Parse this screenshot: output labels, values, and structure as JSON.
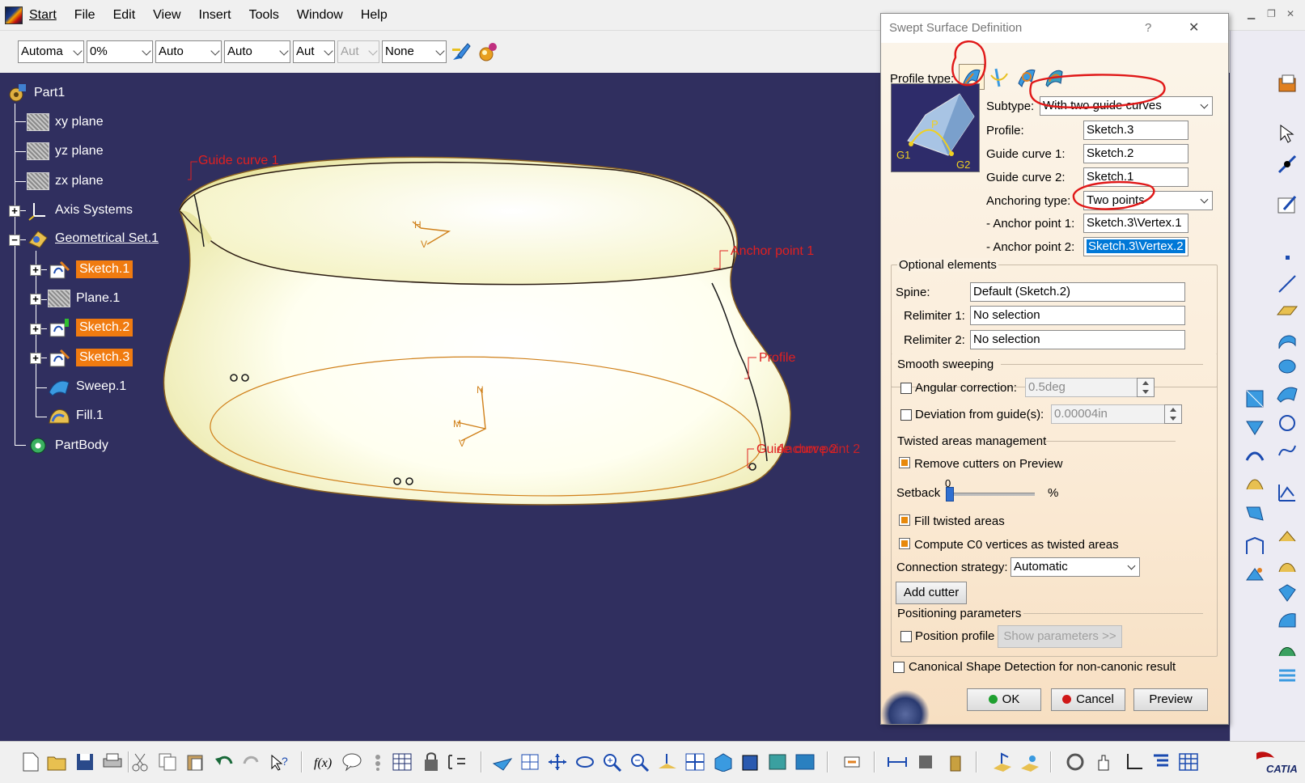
{
  "menu": {
    "items": [
      "Start",
      "File",
      "Edit",
      "View",
      "Insert",
      "Tools",
      "Window",
      "Help"
    ]
  },
  "toolbar": {
    "combos": [
      {
        "value": "Automa",
        "disabled": false
      },
      {
        "value": "0%",
        "disabled": false
      },
      {
        "value": "Auto",
        "disabled": false
      },
      {
        "value": "Auto",
        "disabled": false
      },
      {
        "value": "Aut",
        "disabled": false
      },
      {
        "value": "Aut",
        "disabled": true
      },
      {
        "value": "None",
        "disabled": false
      }
    ]
  },
  "tree": {
    "root": "Part1",
    "xy": "xy plane",
    "yz": "yz plane",
    "zx": "zx plane",
    "axis": "Axis Systems",
    "geoset": "Geometrical Set.1",
    "sketch1": "Sketch.1",
    "plane1": "Plane.1",
    "sketch2": "Sketch.2",
    "sketch3": "Sketch.3",
    "sweep": "Sweep.1",
    "fill": "Fill.1",
    "partbody": "PartBody"
  },
  "annotations": {
    "guide1": "Guide curve 1",
    "anchor1": "Anchor point 1",
    "profile": "Profile",
    "overlap": "Guide curve 2",
    "anchor2": "Anchor point 2"
  },
  "dialog": {
    "title": "Swept Surface Definition",
    "help": "?",
    "close": "✕",
    "profile_type_label": "Profile type:",
    "subtype_label": "Subtype:",
    "subtype_value": "With two guide curves",
    "profile_label": "Profile:",
    "profile_value": "Sketch.3",
    "guide1_label": "Guide curve 1:",
    "guide1_value": "Sketch.2",
    "guide2_label": "Guide curve 2:",
    "guide2_value": "Sketch.1",
    "anchoring_label": "Anchoring type:",
    "anchoring_value": "Two points",
    "anchor1_label": "- Anchor point 1:",
    "anchor1_value": "Sketch.3\\Vertex.1",
    "anchor2_label": "- Anchor point 2:",
    "anchor2_value": "Sketch.3\\Vertex.2",
    "preview_labels": {
      "g1": "G1",
      "g2": "G2",
      "p": "P"
    },
    "optional_title": "Optional elements",
    "spine_label": "Spine:",
    "spine_value": "Default (Sketch.2)",
    "relim1_label": "Relimiter 1:",
    "relim1_value": "No selection",
    "relim2_label": "Relimiter 2:",
    "relim2_value": "No selection",
    "smooth_title": "Smooth sweeping",
    "angular_label": "Angular correction:",
    "angular_value": "0.5deg",
    "deviation_label": "Deviation from guide(s):",
    "deviation_value": "0.00004in",
    "twisted_title": "Twisted areas management",
    "remove_cutters_label": "Remove cutters on Preview",
    "setback_label": "Setback",
    "setback_value": "0",
    "setback_unit": "%",
    "fill_twisted_label": "Fill twisted areas",
    "compute_c0_label": "Compute C0 vertices as twisted areas",
    "connection_label": "Connection strategy:",
    "connection_value": "Automatic",
    "add_cutter": "Add cutter",
    "positioning_title": "Positioning parameters",
    "position_profile_label": "Position profile",
    "show_params": "Show parameters >>",
    "canonical_label": "Canonical Shape Detection for non-canonic result",
    "ok": "OK",
    "cancel": "Cancel",
    "preview": "Preview"
  },
  "colors": {
    "viewport_bg": "#302f5f",
    "highlight": "#f07b10",
    "annotation": "#e02020",
    "selection": "#0078d7"
  }
}
